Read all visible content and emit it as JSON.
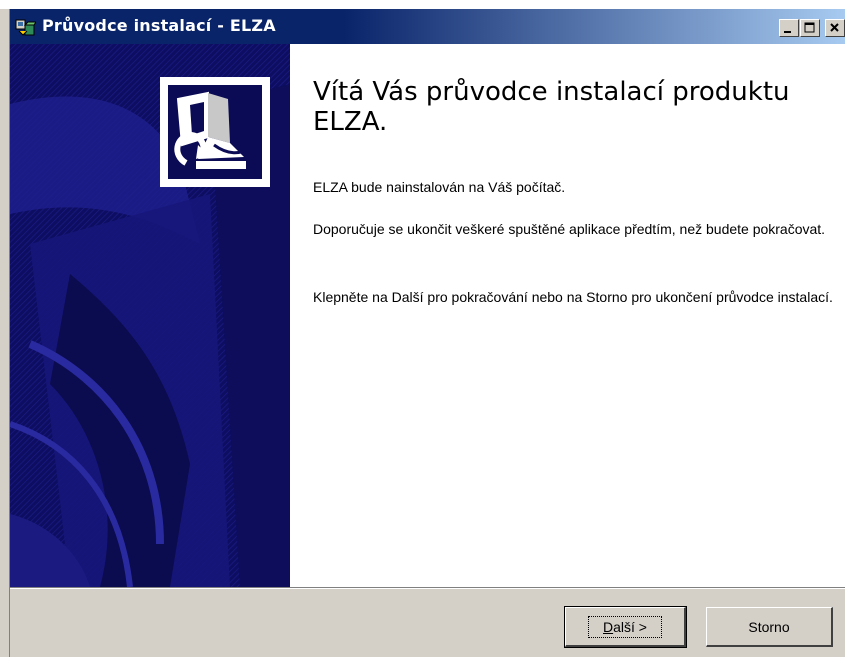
{
  "window": {
    "title": "Průvodce instalací - ELZA",
    "controls": [
      "minimize",
      "maximize",
      "close"
    ]
  },
  "icons": {
    "app": "setup-box-icon",
    "banner": "computer-install-icon"
  },
  "content": {
    "heading": "Vítá Vás průvodce instalací produktu ELZA.",
    "paragraph_1": "ELZA bude nainstalován na Váš počítač.",
    "paragraph_2": "Doporučuje se ukončit veškeré spuštěné aplikace předtím, než budete pokračovat.",
    "paragraph_3": "Klepněte na Další pro pokračování nebo na Storno pro ukončení průvodce instalací."
  },
  "buttons": {
    "next_accesskey": "D",
    "next_rest": "alší >",
    "cancel": "Storno"
  },
  "colors": {
    "titlebar_start": "#0a246a",
    "titlebar_end": "#a6caf0",
    "banner": "#0b0b55",
    "face": "#d4d0c8"
  }
}
